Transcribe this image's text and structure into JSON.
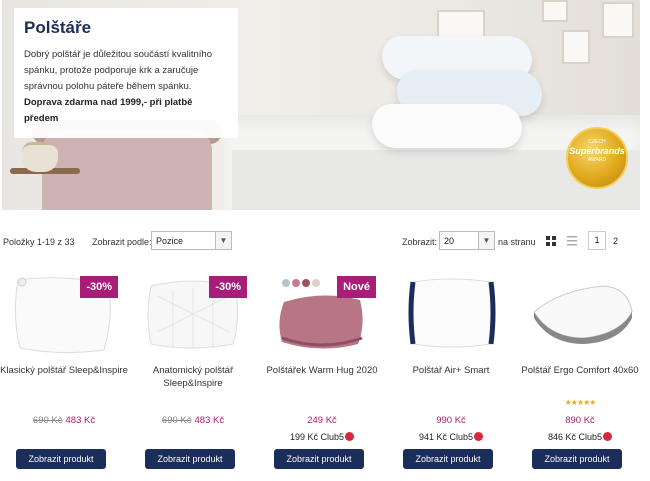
{
  "hero": {
    "title": "Polštáře",
    "text": "Dobrý polštář je důležitou součástí kvalitního spánku, protože podporuje krk a zaručuje správnou polohu páteře během spánku.",
    "bold_text": "Doprava zdarma nad 1999,- při platbě předem",
    "badge_top": "CZECH",
    "badge_name": "Superbrands",
    "badge_bottom": "AWARD"
  },
  "toolbar": {
    "items_count": "Položky 1-19 z 33",
    "sort_label": "Zobrazit podle:",
    "sort_value": "Pozice",
    "limit_label": "Zobrazit:",
    "limit_value": "20",
    "limit_suffix": "na stranu",
    "pages": [
      "1",
      "2"
    ]
  },
  "products": [
    {
      "name": "Klasický polštář Sleep&Inspire",
      "badge": "-30%",
      "old_price": "690 Kč",
      "price": "483 Kč",
      "club": "",
      "stars": "",
      "button": "Zobrazit produkt"
    },
    {
      "name": "Anatomický polštář Sleep&Inspire",
      "badge": "-30%",
      "old_price": "690 Kč",
      "price": "483 Kč",
      "club": "",
      "stars": "",
      "button": "Zobrazit produkt"
    },
    {
      "name": "Polštářek Warm Hug 2020",
      "badge": "Nové",
      "old_price": "",
      "price": "249 Kč",
      "club": "199 Kč Club5",
      "stars": "",
      "button": "Zobrazit produkt"
    },
    {
      "name": "Polštář Air+ Smart",
      "badge": "",
      "old_price": "",
      "price": "990 Kč",
      "club": "941 Kč Club5",
      "stars": "",
      "button": "Zobrazit produkt"
    },
    {
      "name": "Polštář Ergo Comfort 40x60",
      "badge": "",
      "old_price": "",
      "price": "890 Kč",
      "club": "846 Kč Club5",
      "stars": "★★★★★",
      "button": "Zobrazit produkt"
    }
  ],
  "colors": {
    "brand": "#1b2d5b",
    "accent": "#a81d78",
    "club": "#d7263d"
  }
}
